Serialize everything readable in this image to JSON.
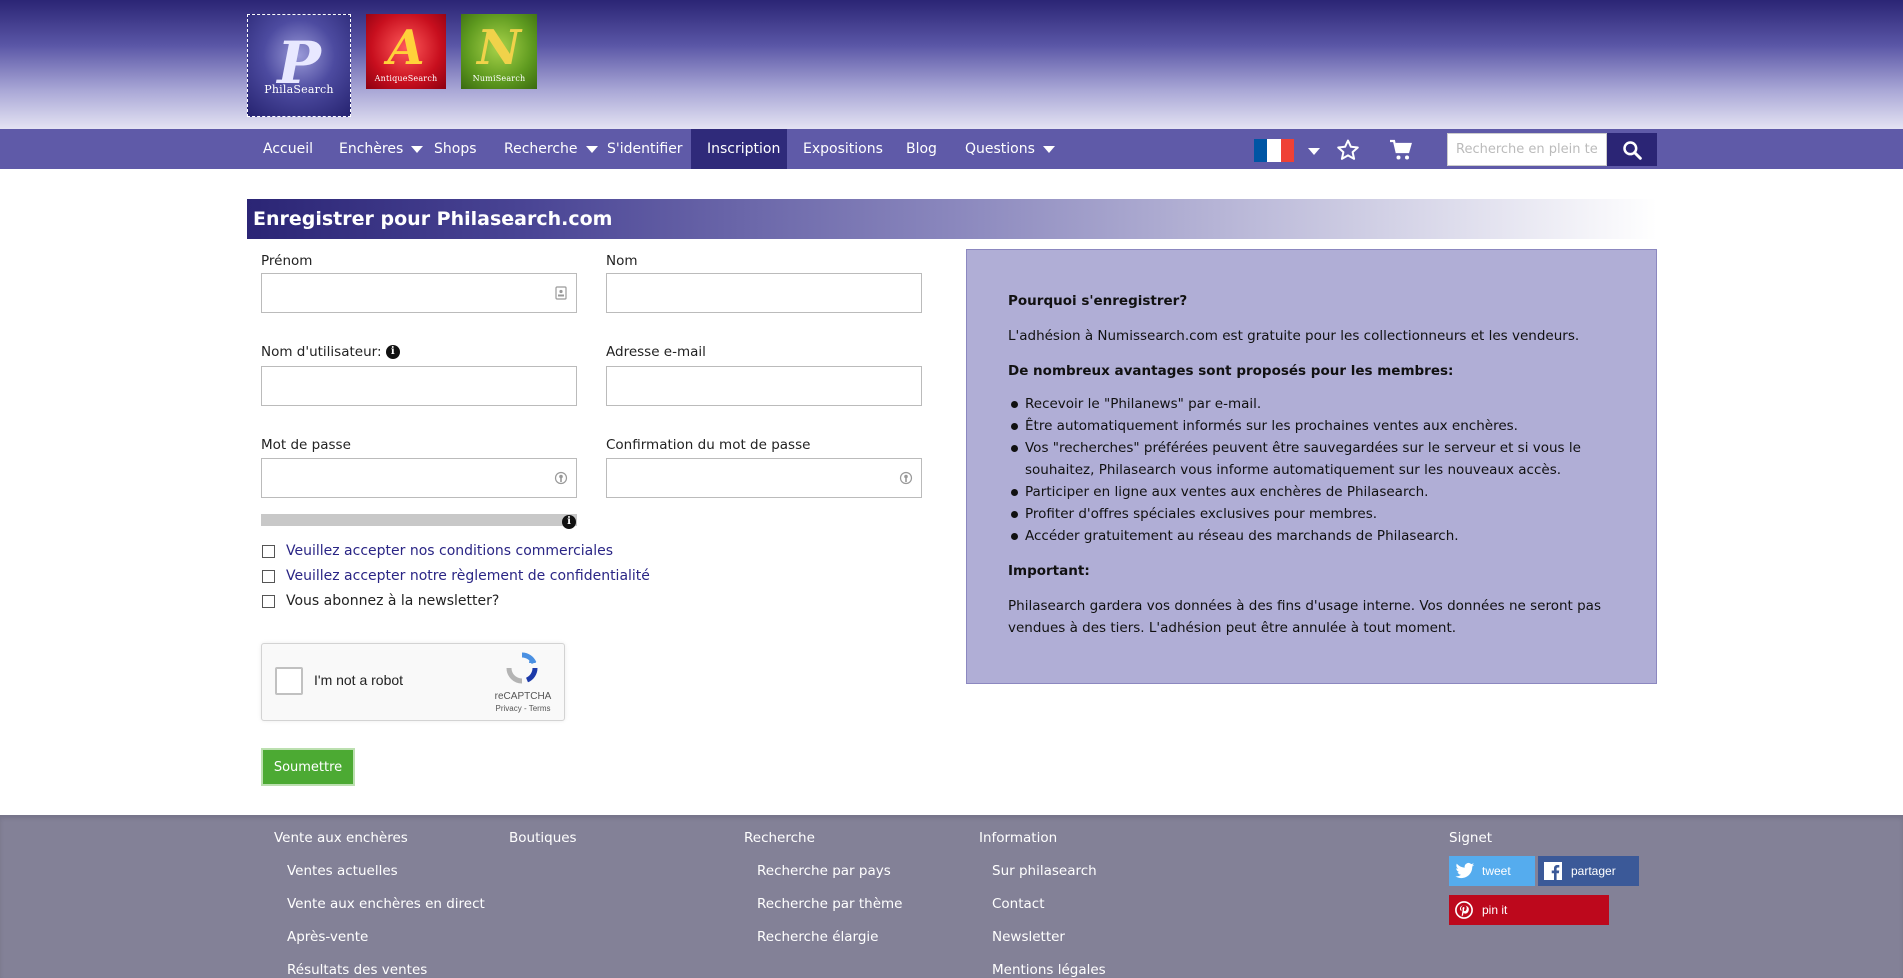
{
  "logos": [
    {
      "name": "PhilaSearch",
      "glyph": "P",
      "text": "PhilaSearch"
    },
    {
      "name": "AntiqueSearch",
      "glyph": "A",
      "text": "AntiqueSearch"
    },
    {
      "name": "NumiSearch",
      "glyph": "N",
      "text": "NumiSearch"
    }
  ],
  "nav": {
    "items": [
      {
        "label": "Accueil"
      },
      {
        "label": "Enchères"
      },
      {
        "label": "Shops"
      },
      {
        "label": "Recherche"
      },
      {
        "label": "S'identifier"
      },
      {
        "label": "Inscription"
      },
      {
        "label": "Expositions"
      },
      {
        "label": "Blog"
      },
      {
        "label": "Questions"
      }
    ],
    "search_placeholder": "Recherche en plein texte",
    "flag_colors": [
      "#0055a4",
      "#ffffff",
      "#ef4135"
    ]
  },
  "form": {
    "title": "Enregistrer pour Philasearch.com",
    "first_name_label": "Prénom",
    "last_name_label": "Nom",
    "username_label": "Nom d'utilisateur:",
    "email_label": "Adresse e-mail",
    "password_label": "Mot de passe",
    "password_confirm_label": "Confirmation du mot de passe",
    "info_glyph": "i",
    "terms_label": "Veuillez accepter nos conditions commerciales",
    "privacy_label": "Veuillez accepter notre règlement de confidentialité",
    "newsletter_label": "Vous abonnez à la newsletter?",
    "submit_label": "Soumettre"
  },
  "captcha": {
    "label": "I'm not a robot",
    "brand": "reCAPTCHA",
    "links": "Privacy - Terms"
  },
  "info_panel": {
    "why_heading": "Pourquoi s'enregistrer?",
    "intro": "L'adhésion à Numissearch.com est gratuite pour les collectionneurs et les vendeurs.",
    "benefits_heading": "De nombreux avantages sont proposés pour les membres:",
    "benefits": [
      "Recevoir le \"Philanews\" par e-mail.",
      "Être automatiquement informés sur les prochaines ventes aux enchères.",
      "Vos \"recherches\" préférées peuvent être sauvegardées sur le serveur et si vous le souhaitez, Philasearch vous informe automatiquement sur les nouveaux accès.",
      "Participer en ligne aux ventes aux enchères de Philasearch.",
      "Profiter d'offres spéciales exclusives pour membres.",
      "Accéder gratuitement au réseau des marchands de Philasearch."
    ],
    "important_heading": "Important:",
    "important_text": "Philasearch gardera vos données à des fins d'usage interne. Vos données ne seront pas vendues à des tiers. L'adhésion peut être annulée à tout moment."
  },
  "footer": {
    "auctions": {
      "heading": "Vente aux enchères",
      "items": [
        "Ventes actuelles",
        "Vente aux enchères en direct",
        "Après-vente",
        "Résultats des ventes"
      ]
    },
    "shops": {
      "heading": "Boutiques"
    },
    "search": {
      "heading": "Recherche",
      "items": [
        "Recherche par pays",
        "Recherche par thème",
        "Recherche élargie"
      ]
    },
    "information": {
      "heading": "Information",
      "items": [
        "Sur philasearch",
        "Contact",
        "Newsletter",
        "Mentions légales"
      ]
    },
    "bookmark": {
      "heading": "Signet",
      "tweet": "tweet",
      "share": "partager",
      "pin": "pin it"
    }
  },
  "colors": {
    "nav_bg": "#5f5aa8",
    "nav_active": "#2f2a7a",
    "submit_green": "#4caa33",
    "panel_bg": "#b0aed6",
    "footer_bg": "#838197",
    "twitter": "#55acee",
    "facebook": "#3b5998",
    "pinterest": "#bd081c"
  }
}
